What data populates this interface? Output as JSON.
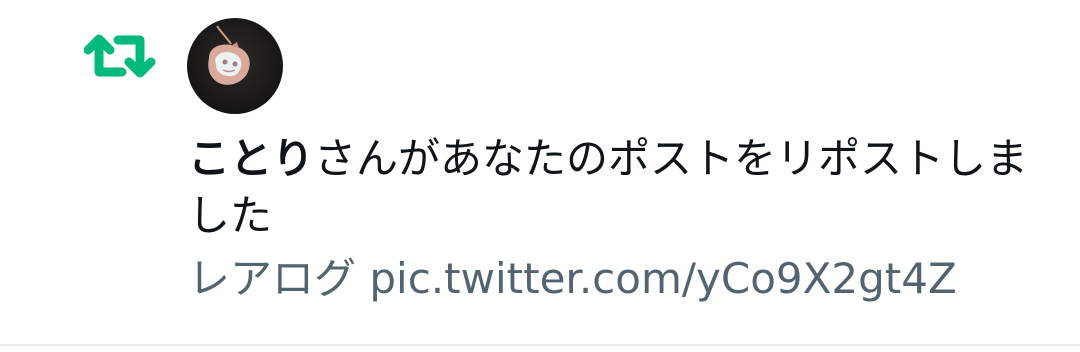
{
  "notification": {
    "type_icon": "retweet-icon",
    "user_name": "ことり",
    "message_suffix": "さんがあなたのポストをリポストしました",
    "post_text": "レアログ",
    "post_link": "pic.twitter.com/yCo9X2gt4Z"
  },
  "colors": {
    "retweet_green": "#00ba7c",
    "text_primary": "#0f1419",
    "text_secondary": "#536471",
    "divider": "#e7e9ea"
  }
}
